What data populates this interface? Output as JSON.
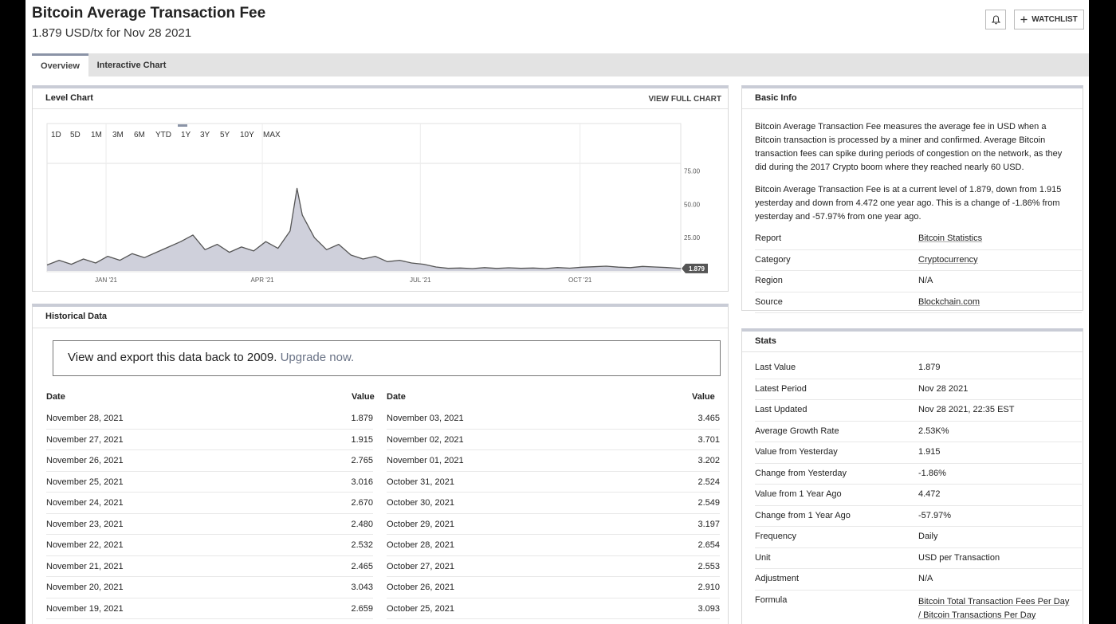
{
  "header": {
    "title": "Bitcoin Average Transaction Fee",
    "subtitle": "1.879 USD/tx for Nov 28 2021",
    "watchlist_label": "WATCHLIST"
  },
  "tabs": [
    {
      "label": "Overview",
      "active": true
    },
    {
      "label": "Interactive Chart",
      "active": false
    }
  ],
  "level_chart": {
    "title": "Level Chart",
    "view_full_label": "VIEW FULL CHART",
    "ranges": [
      "1D",
      "5D",
      "1M",
      "3M",
      "6M",
      "YTD",
      "1Y",
      "3Y",
      "5Y",
      "10Y",
      "MAX"
    ],
    "active_range": "1Y",
    "current_label": "1.879"
  },
  "chart_data": {
    "type": "area",
    "title": "",
    "xlabel": "",
    "ylabel": "",
    "x_ticks": [
      "JAN '21",
      "APR '21",
      "JUL '21",
      "OCT '21"
    ],
    "y_ticks": [
      "25.00",
      "50.00",
      "75.00"
    ],
    "ylim": [
      0,
      85
    ],
    "x": [
      "2020-11-28",
      "2020-12-05",
      "2020-12-12",
      "2020-12-19",
      "2020-12-26",
      "2021-01-02",
      "2021-01-09",
      "2021-01-16",
      "2021-01-23",
      "2021-01-30",
      "2021-02-06",
      "2021-02-13",
      "2021-02-20",
      "2021-02-27",
      "2021-03-06",
      "2021-03-13",
      "2021-03-20",
      "2021-03-27",
      "2021-04-03",
      "2021-04-10",
      "2021-04-17",
      "2021-04-21",
      "2021-04-24",
      "2021-05-01",
      "2021-05-08",
      "2021-05-15",
      "2021-05-22",
      "2021-05-29",
      "2021-06-05",
      "2021-06-12",
      "2021-06-19",
      "2021-06-26",
      "2021-07-03",
      "2021-07-10",
      "2021-07-17",
      "2021-07-24",
      "2021-07-31",
      "2021-08-07",
      "2021-08-14",
      "2021-08-21",
      "2021-08-28",
      "2021-09-04",
      "2021-09-11",
      "2021-09-18",
      "2021-09-25",
      "2021-10-02",
      "2021-10-09",
      "2021-10-16",
      "2021-10-23",
      "2021-10-30",
      "2021-11-06",
      "2021-11-13",
      "2021-11-20",
      "2021-11-28"
    ],
    "series": [
      {
        "values": [
          4.5,
          8,
          5,
          9,
          6,
          11,
          8,
          13,
          10,
          14,
          18,
          22,
          27,
          16,
          20,
          14,
          18,
          15,
          22,
          17,
          30,
          62,
          42,
          25,
          16,
          20,
          12,
          9,
          11,
          7,
          8,
          6,
          5,
          3,
          2,
          2.2,
          1.8,
          2.5,
          1.9,
          2.4,
          2,
          2.2,
          1.8,
          2.6,
          2.1,
          2.8,
          3.2,
          3.6,
          2.9,
          2.5,
          3.4,
          3.0,
          2.6,
          1.879
        ]
      }
    ]
  },
  "basic_info": {
    "title": "Basic Info",
    "para1": "Bitcoin Average Transaction Fee measures the average fee in USD when a Bitcoin transaction is processed by a miner and confirmed. Average Bitcoin transaction fees can spike during periods of congestion on the network, as they did during the 2017 Crypto boom where they reached nearly 60 USD.",
    "para2": "Bitcoin Average Transaction Fee is at a current level of 1.879, down from 1.915 yesterday and down from 4.472 one year ago. This is a change of -1.86% from yesterday and -57.97% from one year ago.",
    "rows": [
      {
        "key": "Report",
        "value": "Bitcoin Statistics",
        "link": true
      },
      {
        "key": "Category",
        "value": "Cryptocurrency",
        "link": true
      },
      {
        "key": "Region",
        "value": "N/A",
        "link": false
      },
      {
        "key": "Source",
        "value": "Blockchain.com",
        "link": true
      }
    ]
  },
  "historical": {
    "title": "Historical Data",
    "upgrade_text": "View and export this data back to 2009. ",
    "upgrade_link": "Upgrade now.",
    "col_date": "Date",
    "col_value": "Value",
    "left": [
      {
        "date": "November 28, 2021",
        "value": "1.879"
      },
      {
        "date": "November 27, 2021",
        "value": "1.915"
      },
      {
        "date": "November 26, 2021",
        "value": "2.765"
      },
      {
        "date": "November 25, 2021",
        "value": "3.016"
      },
      {
        "date": "November 24, 2021",
        "value": "2.670"
      },
      {
        "date": "November 23, 2021",
        "value": "2.480"
      },
      {
        "date": "November 22, 2021",
        "value": "2.532"
      },
      {
        "date": "November 21, 2021",
        "value": "2.465"
      },
      {
        "date": "November 20, 2021",
        "value": "3.043"
      },
      {
        "date": "November 19, 2021",
        "value": "2.659"
      }
    ],
    "right": [
      {
        "date": "November 03, 2021",
        "value": "3.465"
      },
      {
        "date": "November 02, 2021",
        "value": "3.701"
      },
      {
        "date": "November 01, 2021",
        "value": "3.202"
      },
      {
        "date": "October 31, 2021",
        "value": "2.524"
      },
      {
        "date": "October 30, 2021",
        "value": "2.549"
      },
      {
        "date": "October 29, 2021",
        "value": "3.197"
      },
      {
        "date": "October 28, 2021",
        "value": "2.654"
      },
      {
        "date": "October 27, 2021",
        "value": "2.553"
      },
      {
        "date": "October 26, 2021",
        "value": "2.910"
      },
      {
        "date": "October 25, 2021",
        "value": "3.093"
      }
    ]
  },
  "stats": {
    "title": "Stats",
    "rows": [
      {
        "key": "Last Value",
        "value": "1.879",
        "link": false
      },
      {
        "key": "Latest Period",
        "value": "Nov 28 2021",
        "link": false
      },
      {
        "key": "Last Updated",
        "value": "Nov 28 2021, 22:35 EST",
        "link": false
      },
      {
        "key": "Average Growth Rate",
        "value": "2.53K%",
        "link": false
      },
      {
        "key": "Value from Yesterday",
        "value": "1.915",
        "link": false
      },
      {
        "key": "Change from Yesterday",
        "value": "-1.86%",
        "link": false
      },
      {
        "key": "Value from 1 Year Ago",
        "value": "4.472",
        "link": false
      },
      {
        "key": "Change from 1 Year Ago",
        "value": "-57.97%",
        "link": false
      },
      {
        "key": "Frequency",
        "value": "Daily",
        "link": false
      },
      {
        "key": "Unit",
        "value": "USD per Transaction",
        "link": false
      },
      {
        "key": "Adjustment",
        "value": "N/A",
        "link": false
      }
    ],
    "formula_key": "Formula",
    "formula_line1": "Bitcoin Total Transaction Fees Per Day",
    "formula_line2": "/ Bitcoin Transactions Per Day"
  },
  "colors": {
    "area_fill": "#cfd0db",
    "line": "#555555",
    "panel_accent": "#c9ccd6",
    "link_text": "#6a7386"
  }
}
